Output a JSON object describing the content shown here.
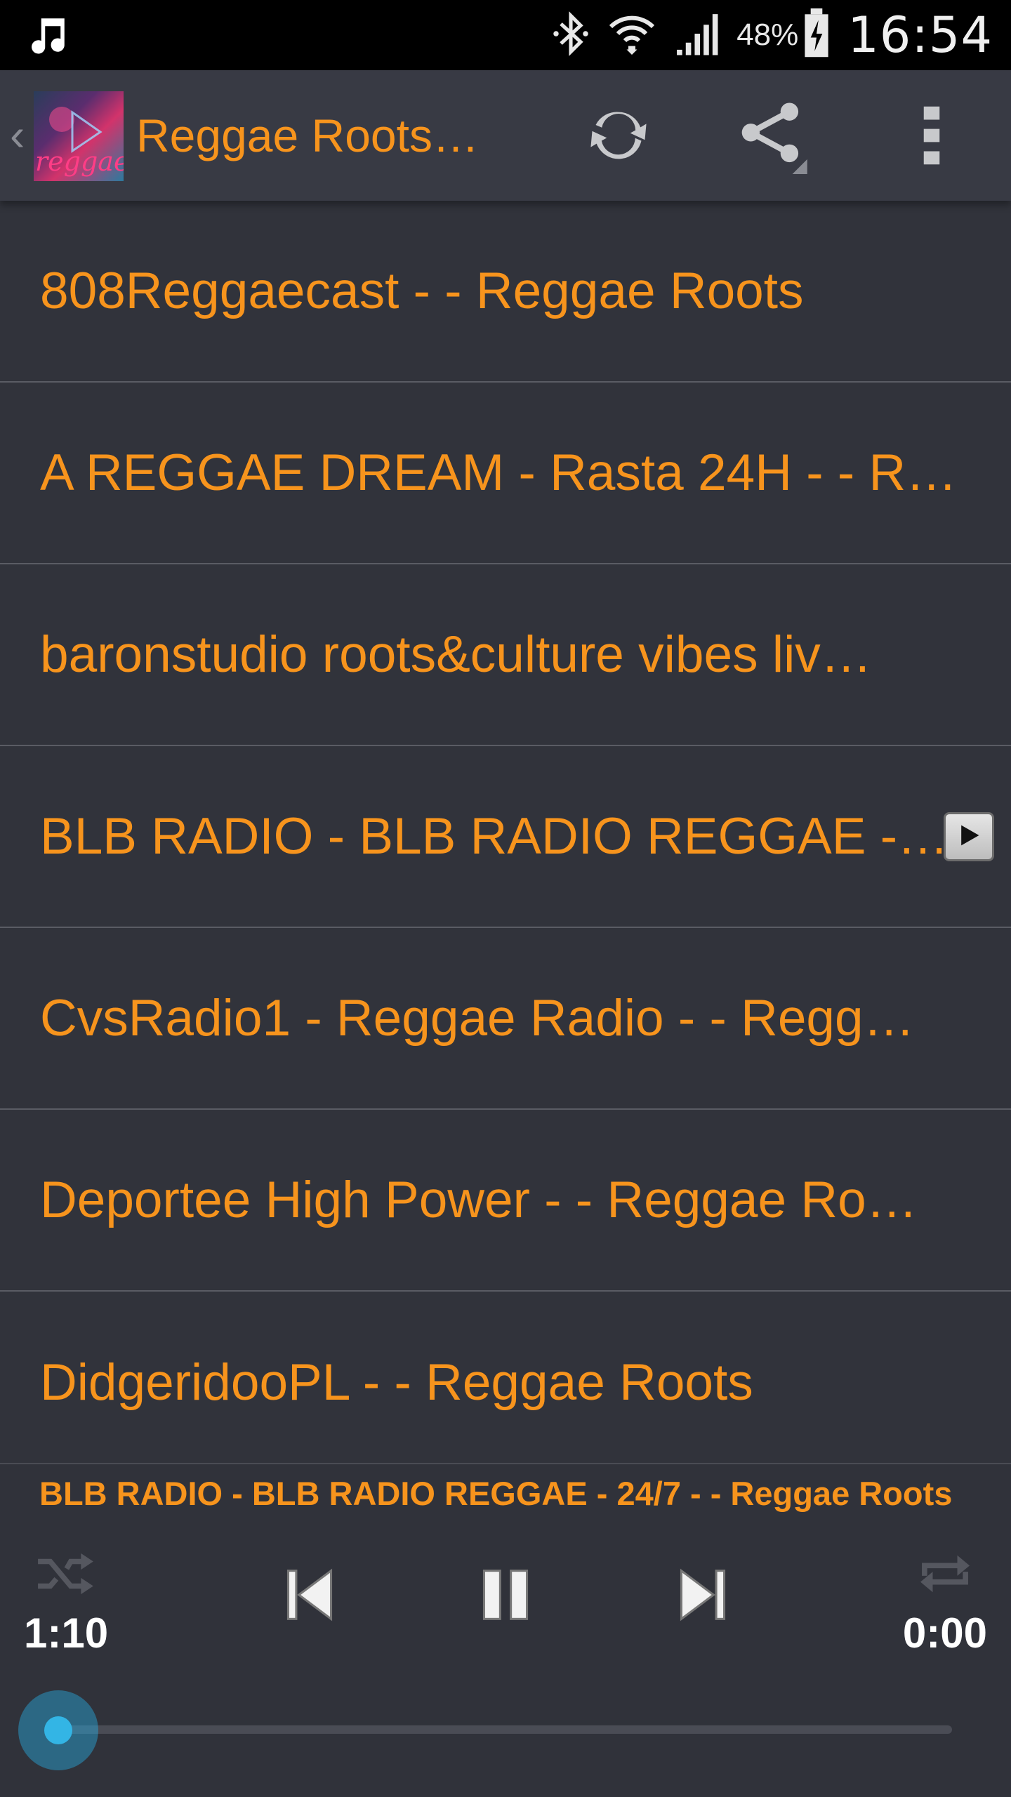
{
  "status_bar": {
    "battery_percent": "48%",
    "time": "16:54",
    "icons": [
      "music-note-icon",
      "bluetooth-icon",
      "wifi-icon",
      "signal-icon",
      "battery-charging-icon"
    ]
  },
  "action_bar": {
    "back_icon": "chevron-left-icon",
    "logo_text": "reggae",
    "title": "Reggae Roots…",
    "actions": [
      "refresh-icon",
      "share-icon",
      "overflow-menu-icon"
    ]
  },
  "stations": [
    {
      "name": "808Reggaecast - - Reggae Roots",
      "playing": false
    },
    {
      "name": "A REGGAE DREAM - Rasta 24H - - R…",
      "playing": false
    },
    {
      "name": "baronstudio roots&culture vibes liv…",
      "playing": false
    },
    {
      "name": "BLB RADIO - BLB RADIO REGGAE -…",
      "playing": true
    },
    {
      "name": "CvsRadio1 - Reggae Radio - - Regg…",
      "playing": false
    },
    {
      "name": "Deportee High Power - - Reggae Ro…",
      "playing": false
    },
    {
      "name": "DidgeridooPL - - Reggae Roots",
      "playing": false
    }
  ],
  "player": {
    "now_playing": "BLB RADIO - BLB RADIO REGGAE - 24/7 - - Reggae Roots",
    "elapsed": "1:10",
    "duration": "0:00",
    "progress_fraction": 0.0,
    "controls": [
      "shuffle-icon",
      "previous-icon",
      "pause-icon",
      "next-icon",
      "repeat-icon"
    ]
  },
  "colors": {
    "accent": "#f7941d",
    "background": "#31333b",
    "action_bar": "#383a44",
    "seek_thumb": "#33b5e5"
  }
}
